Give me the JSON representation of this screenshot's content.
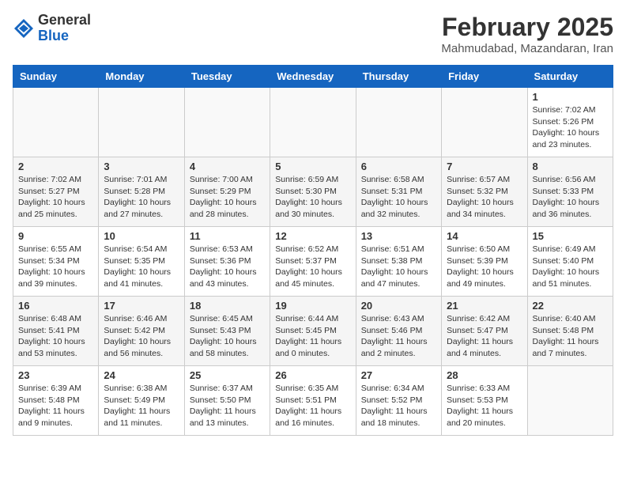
{
  "header": {
    "logo_general": "General",
    "logo_blue": "Blue",
    "month_title": "February 2025",
    "subtitle": "Mahmudabad, Mazandaran, Iran"
  },
  "weekdays": [
    "Sunday",
    "Monday",
    "Tuesday",
    "Wednesday",
    "Thursday",
    "Friday",
    "Saturday"
  ],
  "weeks": [
    {
      "shaded": false,
      "days": [
        {
          "num": "",
          "info": ""
        },
        {
          "num": "",
          "info": ""
        },
        {
          "num": "",
          "info": ""
        },
        {
          "num": "",
          "info": ""
        },
        {
          "num": "",
          "info": ""
        },
        {
          "num": "",
          "info": ""
        },
        {
          "num": "1",
          "info": "Sunrise: 7:02 AM\nSunset: 5:26 PM\nDaylight: 10 hours and 23 minutes."
        }
      ]
    },
    {
      "shaded": true,
      "days": [
        {
          "num": "2",
          "info": "Sunrise: 7:02 AM\nSunset: 5:27 PM\nDaylight: 10 hours and 25 minutes."
        },
        {
          "num": "3",
          "info": "Sunrise: 7:01 AM\nSunset: 5:28 PM\nDaylight: 10 hours and 27 minutes."
        },
        {
          "num": "4",
          "info": "Sunrise: 7:00 AM\nSunset: 5:29 PM\nDaylight: 10 hours and 28 minutes."
        },
        {
          "num": "5",
          "info": "Sunrise: 6:59 AM\nSunset: 5:30 PM\nDaylight: 10 hours and 30 minutes."
        },
        {
          "num": "6",
          "info": "Sunrise: 6:58 AM\nSunset: 5:31 PM\nDaylight: 10 hours and 32 minutes."
        },
        {
          "num": "7",
          "info": "Sunrise: 6:57 AM\nSunset: 5:32 PM\nDaylight: 10 hours and 34 minutes."
        },
        {
          "num": "8",
          "info": "Sunrise: 6:56 AM\nSunset: 5:33 PM\nDaylight: 10 hours and 36 minutes."
        }
      ]
    },
    {
      "shaded": false,
      "days": [
        {
          "num": "9",
          "info": "Sunrise: 6:55 AM\nSunset: 5:34 PM\nDaylight: 10 hours and 39 minutes."
        },
        {
          "num": "10",
          "info": "Sunrise: 6:54 AM\nSunset: 5:35 PM\nDaylight: 10 hours and 41 minutes."
        },
        {
          "num": "11",
          "info": "Sunrise: 6:53 AM\nSunset: 5:36 PM\nDaylight: 10 hours and 43 minutes."
        },
        {
          "num": "12",
          "info": "Sunrise: 6:52 AM\nSunset: 5:37 PM\nDaylight: 10 hours and 45 minutes."
        },
        {
          "num": "13",
          "info": "Sunrise: 6:51 AM\nSunset: 5:38 PM\nDaylight: 10 hours and 47 minutes."
        },
        {
          "num": "14",
          "info": "Sunrise: 6:50 AM\nSunset: 5:39 PM\nDaylight: 10 hours and 49 minutes."
        },
        {
          "num": "15",
          "info": "Sunrise: 6:49 AM\nSunset: 5:40 PM\nDaylight: 10 hours and 51 minutes."
        }
      ]
    },
    {
      "shaded": true,
      "days": [
        {
          "num": "16",
          "info": "Sunrise: 6:48 AM\nSunset: 5:41 PM\nDaylight: 10 hours and 53 minutes."
        },
        {
          "num": "17",
          "info": "Sunrise: 6:46 AM\nSunset: 5:42 PM\nDaylight: 10 hours and 56 minutes."
        },
        {
          "num": "18",
          "info": "Sunrise: 6:45 AM\nSunset: 5:43 PM\nDaylight: 10 hours and 58 minutes."
        },
        {
          "num": "19",
          "info": "Sunrise: 6:44 AM\nSunset: 5:45 PM\nDaylight: 11 hours and 0 minutes."
        },
        {
          "num": "20",
          "info": "Sunrise: 6:43 AM\nSunset: 5:46 PM\nDaylight: 11 hours and 2 minutes."
        },
        {
          "num": "21",
          "info": "Sunrise: 6:42 AM\nSunset: 5:47 PM\nDaylight: 11 hours and 4 minutes."
        },
        {
          "num": "22",
          "info": "Sunrise: 6:40 AM\nSunset: 5:48 PM\nDaylight: 11 hours and 7 minutes."
        }
      ]
    },
    {
      "shaded": false,
      "days": [
        {
          "num": "23",
          "info": "Sunrise: 6:39 AM\nSunset: 5:48 PM\nDaylight: 11 hours and 9 minutes."
        },
        {
          "num": "24",
          "info": "Sunrise: 6:38 AM\nSunset: 5:49 PM\nDaylight: 11 hours and 11 minutes."
        },
        {
          "num": "25",
          "info": "Sunrise: 6:37 AM\nSunset: 5:50 PM\nDaylight: 11 hours and 13 minutes."
        },
        {
          "num": "26",
          "info": "Sunrise: 6:35 AM\nSunset: 5:51 PM\nDaylight: 11 hours and 16 minutes."
        },
        {
          "num": "27",
          "info": "Sunrise: 6:34 AM\nSunset: 5:52 PM\nDaylight: 11 hours and 18 minutes."
        },
        {
          "num": "28",
          "info": "Sunrise: 6:33 AM\nSunset: 5:53 PM\nDaylight: 11 hours and 20 minutes."
        },
        {
          "num": "",
          "info": ""
        }
      ]
    }
  ]
}
